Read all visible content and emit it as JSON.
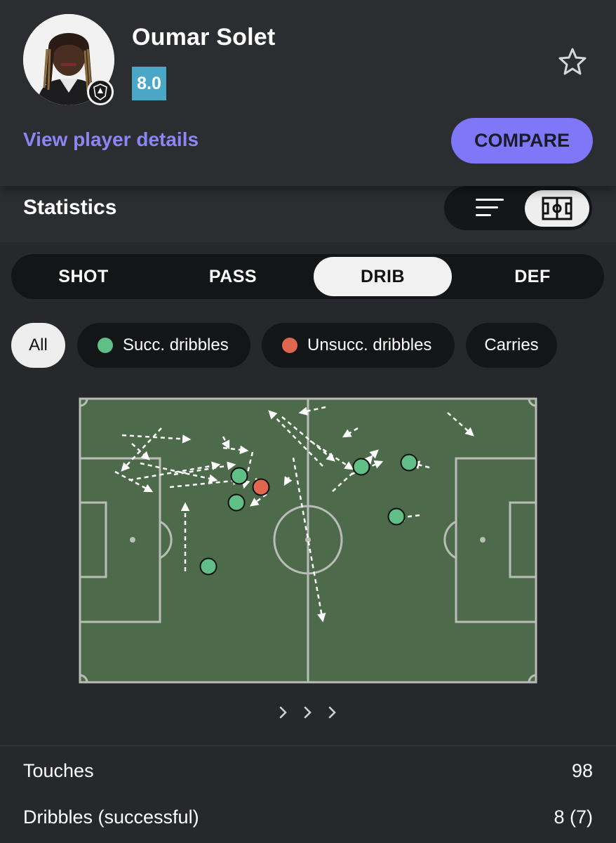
{
  "player": {
    "name": "Oumar Solet",
    "rating": "8.0",
    "details_link": "View player details",
    "compare_label": "COMPARE"
  },
  "statistics": {
    "title": "Statistics"
  },
  "tabs": [
    {
      "label": "SHOT",
      "active": false
    },
    {
      "label": "PASS",
      "active": false
    },
    {
      "label": "DRIB",
      "active": true
    },
    {
      "label": "DEF",
      "active": false
    }
  ],
  "filters": [
    {
      "label": "All",
      "active": true
    },
    {
      "label": "Succ. dribbles",
      "color": "#5fbf87"
    },
    {
      "label": "Unsucc. dribbles",
      "color": "#e06650"
    },
    {
      "label": "Carries"
    }
  ],
  "colors": {
    "pitch": "#4d6b4a",
    "lines": "#b9bdb8",
    "success": "#5fbf87",
    "fail": "#e06650",
    "accent": "#7e78f8",
    "rating": "#4aa7c8"
  },
  "footer_stats": [
    {
      "label": "Touches",
      "value": "98"
    },
    {
      "label": "Dribbles (successful)",
      "value": "8 (7)"
    }
  ]
}
